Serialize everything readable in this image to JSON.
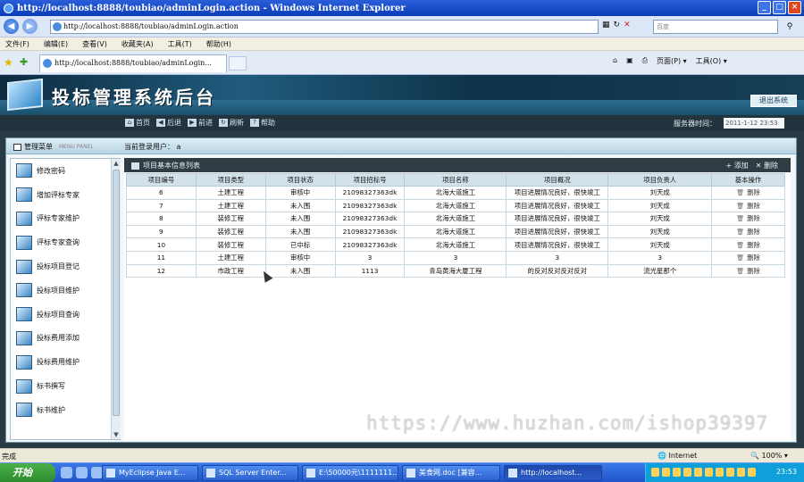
{
  "window": {
    "title": "http://localhost:8888/toubiao/adminLogin.action - Windows Internet Explorer"
  },
  "browser": {
    "address": "http://localhost:8888/toubiao/adminLogin.action",
    "search_placeholder": "百度",
    "menu": [
      "文件(F)",
      "编辑(E)",
      "查看(V)",
      "收藏夹(A)",
      "工具(T)",
      "帮助(H)"
    ],
    "tab_title": "http://localhost:8888/toubiao/adminLogin...",
    "cmd": [
      "页面(P) ▾",
      "工具(O) ▾"
    ]
  },
  "app": {
    "title": "投标管理系统后台",
    "logout": "退出系统",
    "nav": [
      "首页",
      "后退",
      "前进",
      "刷新",
      "帮助"
    ],
    "server_time_label": "服务器时间：",
    "server_time": "2011-1-12 23:53",
    "panel_title": "管理菜单",
    "panel_sub": "MENU PANEL",
    "current_user_label": "当前登录用户：",
    "current_user": "a",
    "sidebar": [
      "修改密码",
      "增加评标专家",
      "评标专家维护",
      "评标专家查询",
      "投标项目登记",
      "投标项目维护",
      "投标项目查询",
      "投标费用添加",
      "投标费用维护",
      "标书撰写",
      "标书维护"
    ],
    "list_title": "项目基本信息列表",
    "add": "添加",
    "delete": "删除",
    "columns": [
      "项目编号",
      "项目类型",
      "项目状态",
      "项目招标号",
      "项目名称",
      "项目概况",
      "项目负责人",
      "基本操作"
    ],
    "rows": [
      [
        "6",
        "土建工程",
        "审核中",
        "21098327363dk",
        "北海大道施工",
        "项目进展情况良好，很快竣工",
        "刘天成",
        "删除"
      ],
      [
        "7",
        "土建工程",
        "未入围",
        "21098327363dk",
        "北海大道施工",
        "项目进展情况良好，很快竣工",
        "刘天成",
        "删除"
      ],
      [
        "8",
        "装修工程",
        "未入围",
        "21098327363dk",
        "北海大道施工",
        "项目进展情况良好，很快竣工",
        "刘天成",
        "删除"
      ],
      [
        "9",
        "装修工程",
        "未入围",
        "21098327363dk",
        "北海大道施工",
        "项目进展情况良好，很快竣工",
        "刘天成",
        "删除"
      ],
      [
        "10",
        "装修工程",
        "已中标",
        "21098327363dk",
        "北海大道施工",
        "项目进展情况良好，很快竣工",
        "刘天成",
        "删除"
      ],
      [
        "11",
        "土建工程",
        "审核中",
        "3",
        "3",
        "3",
        "3",
        "删除"
      ],
      [
        "12",
        "市政工程",
        "未入围",
        "1113",
        "青岛黄海大厦工程",
        "的反对反对反对反对",
        "流光星那个",
        "删除"
      ]
    ]
  },
  "watermark": "https://www.huzhan.com/ishop39397",
  "statusbar": {
    "left": "完成",
    "zone": "Internet",
    "zoom": "100%"
  },
  "taskbar": {
    "start": "开始",
    "buttons": [
      "MyEclipse Java E...",
      "SQL Server Enter...",
      "E:\\50000元\\1111111...",
      "美食网.doc [兼容...",
      "http://localhost..."
    ],
    "clock": "23:53"
  }
}
